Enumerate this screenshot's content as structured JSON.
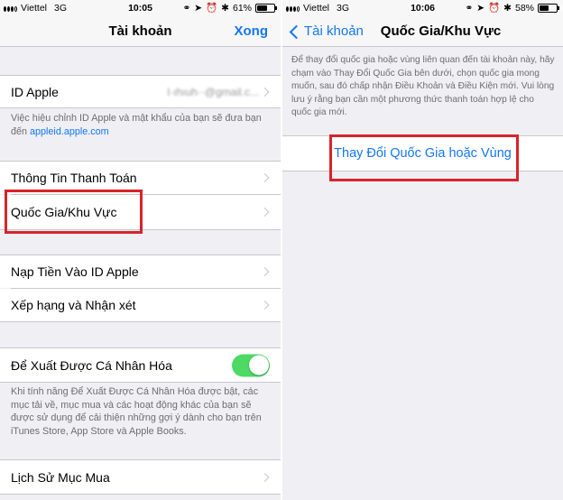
{
  "left_screen": {
    "status": {
      "carrier": "Viettel",
      "network": "3G",
      "time": "10:05",
      "battery_text": "61%",
      "battery_level": 0.61
    },
    "nav": {
      "title": "Tài khoản",
      "action": "Xong"
    },
    "apple_id_row": {
      "label": "ID Apple",
      "value": "l·ıhıuh··@gmail.c..."
    },
    "apple_id_note": {
      "text": "Việc hiệu chỉnh ID Apple và mật khẩu của bạn sẽ đưa bạn đến ",
      "link": "appleid.apple.com"
    },
    "payment_row": {
      "label": "Thông Tin Thanh Toán"
    },
    "region_row": {
      "label": "Quốc Gia/Khu Vực"
    },
    "topup_row": {
      "label": "Nạp Tiền Vào ID Apple"
    },
    "ratings_row": {
      "label": "Xếp hạng và Nhận xét"
    },
    "personalized_row": {
      "label": "Để Xuất Được Cá Nhân Hóa",
      "enabled": true
    },
    "personalized_note": "Khi tính năng Để Xuất Được Cá Nhân Hóa được bật, các mục tải về, mục mua và các hoạt động khác của bạn sẽ được sử dụng để cải thiện những gợi ý dành cho bạn trên iTunes Store, App Store và Apple Books.",
    "history_row": {
      "label": "Lịch Sử Mục Mua"
    }
  },
  "right_screen": {
    "status": {
      "carrier": "Viettel",
      "network": "3G",
      "time": "10:06",
      "battery_text": "58%",
      "battery_level": 0.58
    },
    "nav": {
      "back_label": "Tài khoản",
      "title": "Quốc Gia/Khu Vực"
    },
    "info": "Để thay đổi quốc gia hoặc vùng liên quan đến tài khoản này, hãy chạm vào Thay Đổi Quốc Gia bên dưới, chọn quốc gia mong muốn, sau đó chấp nhận Điều Khoản và Điều Kiện mới. Vui lòng lưu ý rằng bạn cần một phương thức thanh toán hợp lệ cho quốc gia mới.",
    "change_button": "Thay Đổi Quốc Gia hoặc Vùng"
  },
  "colors": {
    "accent": "#1476f5",
    "highlight": "#d9232a",
    "toggle_on": "#4cd964",
    "background": "#efeff4"
  },
  "icons": [
    "signal-icon",
    "lock-rotation-icon",
    "location-icon",
    "alarm-icon",
    "bluetooth-icon",
    "battery-icon",
    "chevron-right-icon",
    "back-chevron-icon"
  ]
}
